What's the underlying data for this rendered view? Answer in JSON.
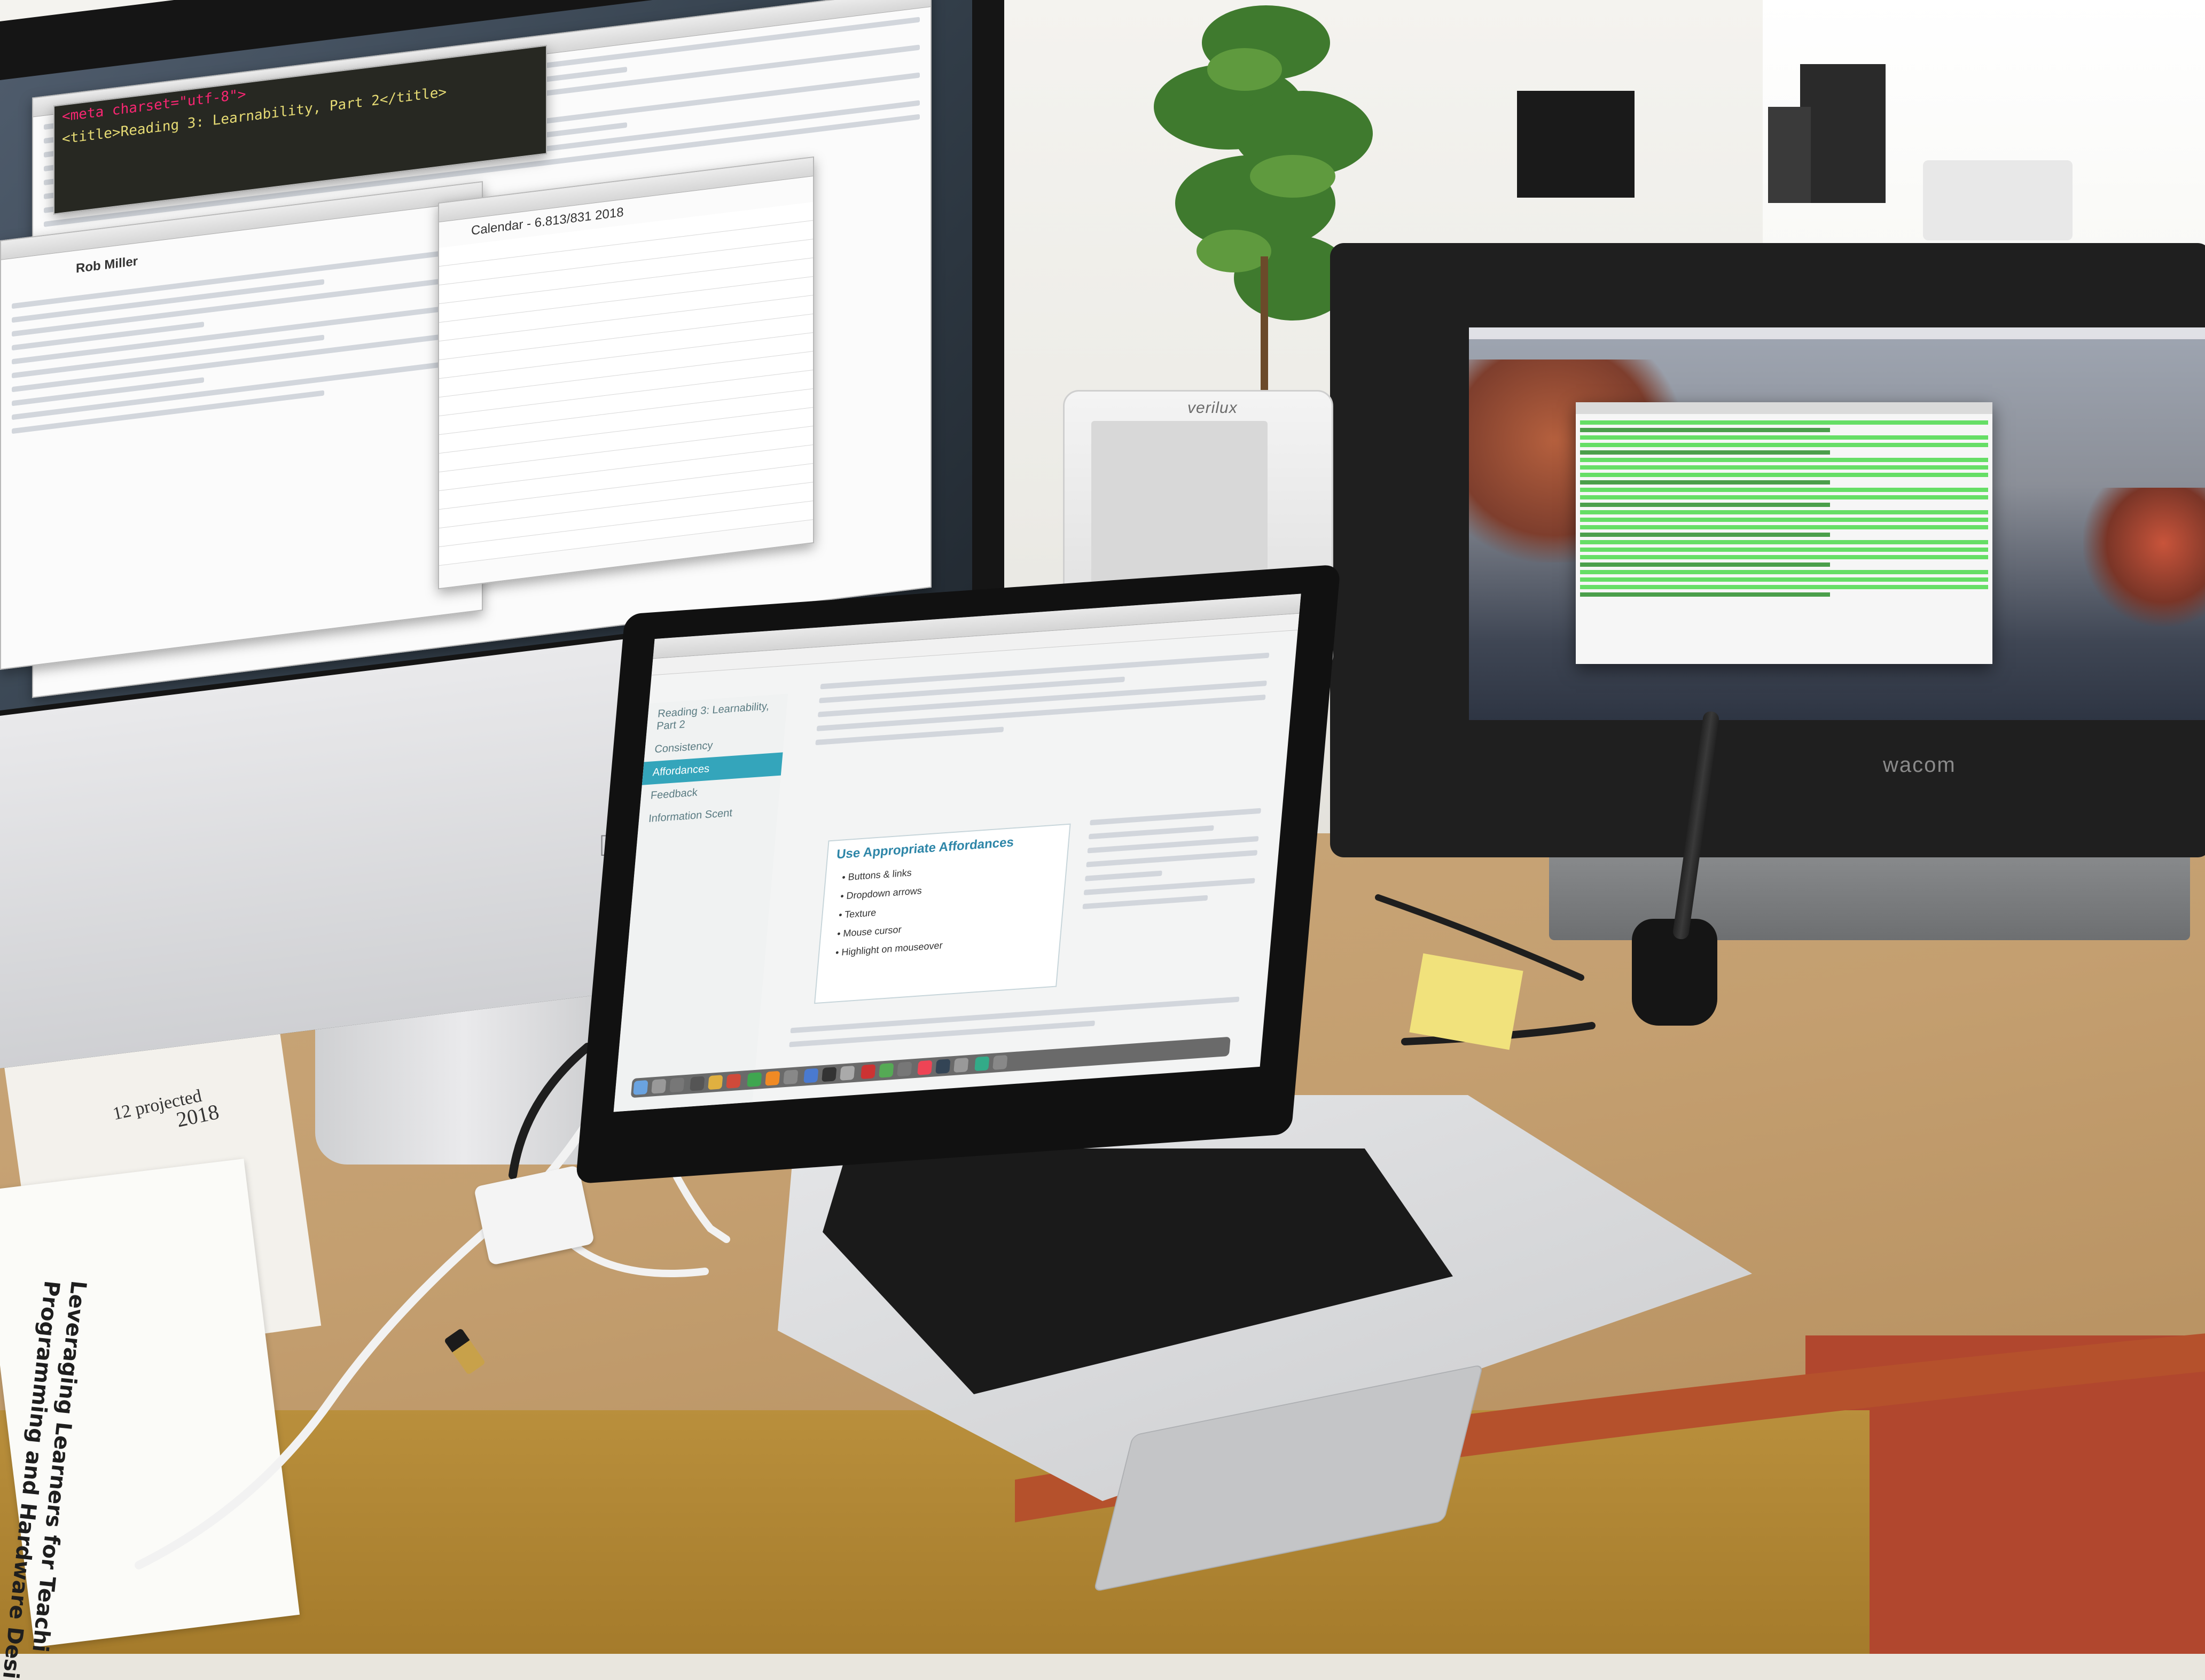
{
  "scene": {
    "description_labels": {
      "left_monitor_window_sender": "Rob Miller",
      "spreadsheet_title": "Calendar - 6.813/831 2018",
      "code_title_line": "<title>Reading 3: Learnability, Part 2</title>",
      "code_meta_line": "<meta charset=\"utf-8\">",
      "laptop_card_title": "Use Appropriate Affordances",
      "laptop_card_items": [
        "Buttons & links",
        "Dropdown arrows",
        "Texture",
        "Mouse cursor",
        "Highlight on mouseover"
      ],
      "laptop_sidebar_items": [
        "Reading 3: Learnability, Part 2",
        "Consistency",
        "Affordances",
        "Feedback",
        "Information Scent"
      ],
      "laptop_sidebar_active": 2,
      "lightbox_brand": "verilux",
      "tablet_brand": "wacom",
      "paper_title_line1": "Leveraging Learners for Teachi",
      "paper_title_line2": "Programming and Hardware Desi",
      "paper_top_text": "12 projected",
      "paper_year": "2018"
    }
  },
  "colors": {
    "terminal_green": "#4cd94c",
    "affordance_accent": "#34a5bb",
    "desk": "#c49f70"
  },
  "icons": {
    "left_monitor_logo": "apple-logo-icon",
    "dock": "dock-app-icons"
  }
}
